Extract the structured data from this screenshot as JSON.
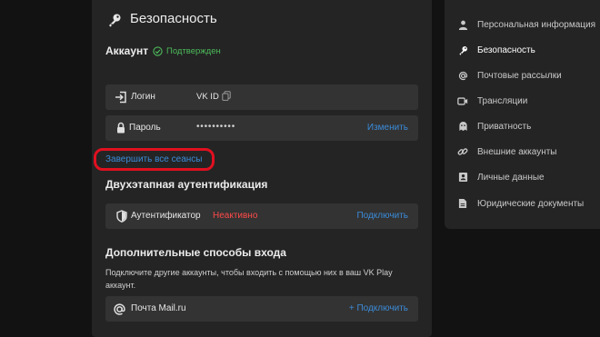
{
  "security": {
    "title": "Безопасность",
    "account_label": "Аккаунт",
    "verified_label": "Подтвержден",
    "login_label": "Логин",
    "login_value": "VK ID",
    "password_label": "Пароль",
    "password_value": "••••••••••",
    "change_label": "Изменить",
    "end_sessions_label": "Завершить все сеансы",
    "two_factor_title": "Двухэтапная аутентификация",
    "authenticator_label": "Аутентификатор",
    "authenticator_status": "Неактивно",
    "connect_label": "Подключить",
    "extra_login_title": "Дополнительные способы входа",
    "extra_login_description": "Подключите другие аккаунты, чтобы входить с помощью них в ваш VK Play аккаунт.",
    "mail_label": "Почта Mail.ru",
    "mail_connect_label": "+ Подключить"
  },
  "sidebar": {
    "items": [
      {
        "label": "Персональная информация",
        "icon": "person-icon"
      },
      {
        "label": "Безопасность",
        "icon": "key-icon"
      },
      {
        "label": "Почтовые рассылки",
        "icon": "at-icon"
      },
      {
        "label": "Трансляции",
        "icon": "video-icon"
      },
      {
        "label": "Приватность",
        "icon": "ghost-icon"
      },
      {
        "label": "Внешние аккаунты",
        "icon": "link-icon"
      },
      {
        "label": "Личные данные",
        "icon": "id-card-icon"
      },
      {
        "label": "Юридические документы",
        "icon": "document-icon"
      }
    ]
  },
  "colors": {
    "accent": "#3b8bd8",
    "success": "#4cbb5a",
    "danger": "#ff4a4a",
    "highlight": "#e01020"
  }
}
